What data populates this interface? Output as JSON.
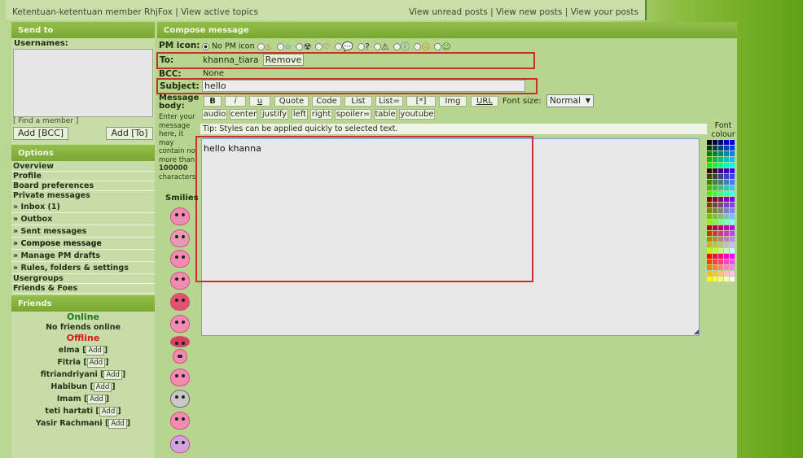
{
  "topbar": {
    "left_link_1": "Ketentuan-ketentuan member RhjFox",
    "separator": "|",
    "left_link_2": "View active topics",
    "right_link_1": "View unread posts",
    "right_link_2": "View new posts",
    "right_link_3": "View your posts"
  },
  "send_to": {
    "header": "Send to",
    "usernames_label": "Usernames:",
    "find_member": "[ Find a member ]",
    "add_bcc": "Add [BCC]",
    "add_to": "Add [To]"
  },
  "options": {
    "header": "Options",
    "items": [
      "Overview",
      "Profile",
      "Board preferences",
      "Private messages",
      "» Inbox (1)",
      "» Outbox",
      "» Sent messages",
      "» Compose message",
      "» Manage PM drafts",
      "» Rules, folders & settings",
      "Usergroups",
      "Friends & Foes"
    ]
  },
  "friends": {
    "header": "Friends",
    "online_label": "Online",
    "no_friends_online": "No friends online",
    "offline_label": "Offline",
    "add_label": "Add",
    "offline_list": [
      "elma",
      "Fitria",
      "fitriandriyani",
      "Habibun",
      "Imam",
      "teti hartati",
      "Yasir Rachmani"
    ]
  },
  "compose": {
    "header": "Compose message",
    "pm_icon_label": "PM icon:",
    "no_pm_icon": "No PM icon",
    "to_label": "To:",
    "to_recipient": "khanna_tiara",
    "remove_button": "Remove",
    "bcc_label": "BCC:",
    "bcc_value": "None",
    "subject_label": "Subject:",
    "subject_value": "hello",
    "message_body_label": "Message body:",
    "message_hint_1": "Enter your",
    "message_hint_2": "message",
    "message_hint_3": "here, it",
    "message_hint_4": "may",
    "message_hint_5": "contain no",
    "message_hint_6": "more than",
    "message_hint_limit": "100000",
    "message_hint_7": "characters.",
    "smilies_label": "Smilies",
    "tip": "Tip: Styles can be applied quickly to selected text.",
    "message_value": "hello khanna",
    "font_size_label": "Font size:",
    "font_size_value": "Normal",
    "font_colour_label_1": "Font",
    "font_colour_label_2": "colour",
    "toolbar_row1": [
      "B",
      "i",
      "u",
      "Quote",
      "Code",
      "List",
      "List=",
      "[*]",
      "Img",
      "URL"
    ],
    "toolbar_row2": [
      "audio",
      "center",
      "justify",
      "left",
      "right",
      "spoiler=",
      "table",
      "youtube"
    ]
  },
  "colors": {
    "accent_green": "#7aa832",
    "highlight_red": "#c9302c",
    "online_green": "#1f7a12",
    "offline_red": "#e01515"
  }
}
